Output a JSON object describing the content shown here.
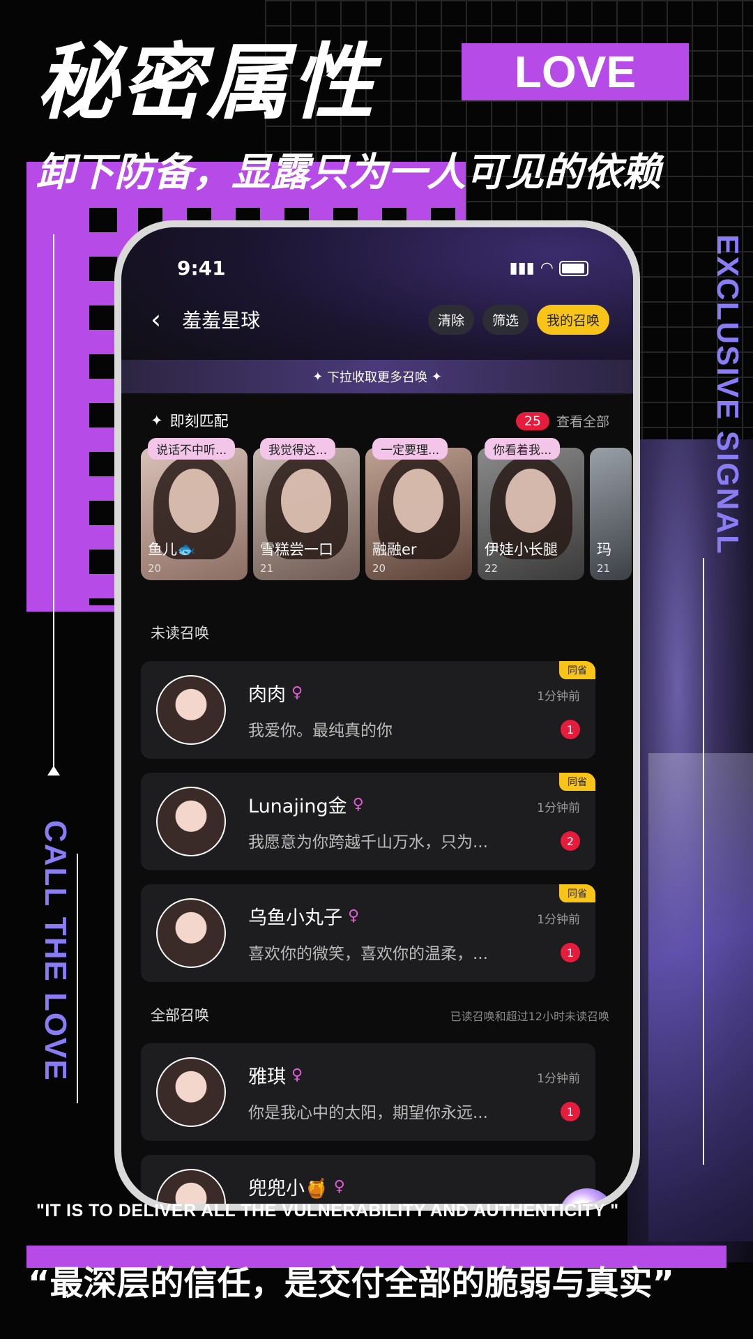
{
  "poster": {
    "title": "秘密属性",
    "love_badge": "LOVE",
    "subtitle": "卸下防备，显露只为一人可见的依赖",
    "side_right": "EXCLUSIVE SIGNAL",
    "side_left": "CALL THE LOVE",
    "quote_en": "\"IT IS TO DELIVER ALL THE VULNERABILITY AND AUTHENTICITY \"",
    "quote_cn": "“最深层的信任，是交付全部的脆弱与真实”",
    "accent_color": "#b64be8",
    "secondary_color": "#8a7cf5"
  },
  "status": {
    "time": "9:41"
  },
  "nav": {
    "back_icon": "chevron-left-icon",
    "title": "羞羞星球",
    "clear": "清除",
    "filter": "筛选",
    "my_calls": "我的召唤"
  },
  "banner": {
    "text": "下拉收取更多召唤"
  },
  "instant": {
    "label": "即刻匹配",
    "count": "25",
    "view_all": "查看全部",
    "cards": [
      {
        "bubble": "说话不中听...",
        "name": "鱼儿🐟",
        "age": "20"
      },
      {
        "bubble": "我觉得这...",
        "name": "雪糕尝一口",
        "age": "21"
      },
      {
        "bubble": "一定要理...",
        "name": "融融er",
        "age": "20"
      },
      {
        "bubble": "你看着我...",
        "name": "伊娃小长腿",
        "age": "22"
      },
      {
        "bubble": "",
        "name": "玛",
        "age": "21"
      }
    ]
  },
  "unread": {
    "label": "未读召唤",
    "items": [
      {
        "name": "肉肉",
        "time": "1分钟前",
        "text": "我爱你。最纯真的你",
        "count": "1",
        "tag": "同省"
      },
      {
        "name": "Lunajing金",
        "time": "1分钟前",
        "text": "我愿意为你跨越千山万水，只为...",
        "count": "2",
        "tag": "同省"
      },
      {
        "name": "乌鱼小丸子",
        "time": "1分钟前",
        "text": "喜欢你的微笑，喜欢你的温柔，...",
        "count": "1",
        "tag": "同省"
      }
    ]
  },
  "all": {
    "label": "全部召唤",
    "note": "已读召唤和超过12小时未读召唤",
    "items": [
      {
        "name": "雅琪",
        "time": "1分钟前",
        "text": "你是我心中的太阳，期望你永远...",
        "count": "1"
      },
      {
        "name": "兜兜小🍯",
        "time": "",
        "text": "",
        "count": ""
      }
    ]
  }
}
